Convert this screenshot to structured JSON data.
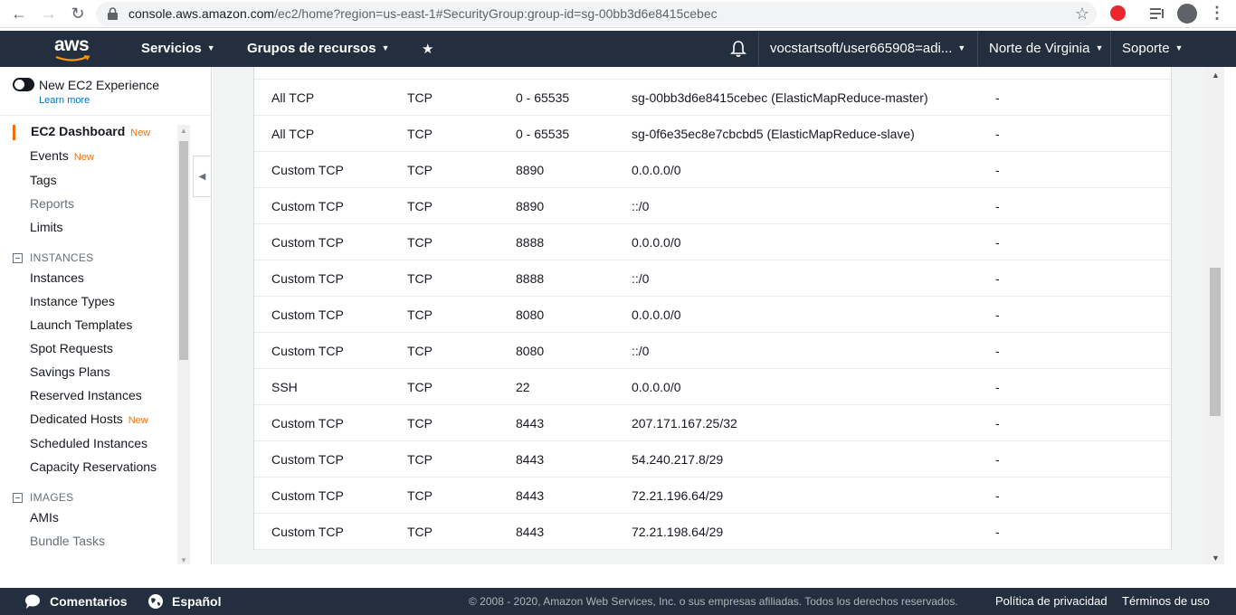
{
  "browser": {
    "url_domain": "console.aws.amazon.com",
    "url_path": "/ec2/home?region=us-east-1#SecurityGroup:group-id=sg-00bb3d6e8415cebec"
  },
  "header": {
    "logo": "aws",
    "services": "Servicios",
    "resource_groups": "Grupos de recursos",
    "account": "vocstartsoft/user665908=adi...",
    "region": "Norte de Virginia",
    "support": "Soporte"
  },
  "sidebar": {
    "new_experience": "New EC2 Experience",
    "learn_more": "Learn more",
    "badge_new": "New",
    "top_items": [
      {
        "label": "EC2 Dashboard",
        "new": true
      },
      {
        "label": "Events",
        "new": true
      },
      {
        "label": "Tags",
        "new": false
      },
      {
        "label": "Reports",
        "new": false
      },
      {
        "label": "Limits",
        "new": false
      }
    ],
    "sections": [
      {
        "title": "INSTANCES",
        "items": [
          {
            "label": "Instances"
          },
          {
            "label": "Instance Types"
          },
          {
            "label": "Launch Templates"
          },
          {
            "label": "Spot Requests"
          },
          {
            "label": "Savings Plans"
          },
          {
            "label": "Reserved Instances"
          },
          {
            "label": "Dedicated Hosts",
            "new": true
          },
          {
            "label": "Scheduled Instances"
          },
          {
            "label": "Capacity Reservations"
          }
        ]
      },
      {
        "title": "IMAGES",
        "items": [
          {
            "label": "AMIs"
          },
          {
            "label": "Bundle Tasks"
          }
        ]
      }
    ]
  },
  "rules": [
    {
      "type": "All TCP",
      "protocol": "TCP",
      "port": "0 - 65535",
      "source": "sg-00bb3d6e8415cebec (ElasticMapReduce-master)",
      "description": "-"
    },
    {
      "type": "All TCP",
      "protocol": "TCP",
      "port": "0 - 65535",
      "source": "sg-0f6e35ec8e7cbcbd5 (ElasticMapReduce-slave)",
      "description": "-"
    },
    {
      "type": "Custom TCP",
      "protocol": "TCP",
      "port": "8890",
      "source": "0.0.0.0/0",
      "description": "-"
    },
    {
      "type": "Custom TCP",
      "protocol": "TCP",
      "port": "8890",
      "source": "::/0",
      "description": "-"
    },
    {
      "type": "Custom TCP",
      "protocol": "TCP",
      "port": "8888",
      "source": "0.0.0.0/0",
      "description": "-"
    },
    {
      "type": "Custom TCP",
      "protocol": "TCP",
      "port": "8888",
      "source": "::/0",
      "description": "-"
    },
    {
      "type": "Custom TCP",
      "protocol": "TCP",
      "port": "8080",
      "source": "0.0.0.0/0",
      "description": "-"
    },
    {
      "type": "Custom TCP",
      "protocol": "TCP",
      "port": "8080",
      "source": "::/0",
      "description": "-"
    },
    {
      "type": "SSH",
      "protocol": "TCP",
      "port": "22",
      "source": "0.0.0.0/0",
      "description": "-"
    },
    {
      "type": "Custom TCP",
      "protocol": "TCP",
      "port": "8443",
      "source": "207.171.167.25/32",
      "description": "-"
    },
    {
      "type": "Custom TCP",
      "protocol": "TCP",
      "port": "8443",
      "source": "54.240.217.8/29",
      "description": "-"
    },
    {
      "type": "Custom TCP",
      "protocol": "TCP",
      "port": "8443",
      "source": "72.21.196.64/29",
      "description": "-"
    },
    {
      "type": "Custom TCP",
      "protocol": "TCP",
      "port": "8443",
      "source": "72.21.198.64/29",
      "description": "-"
    }
  ],
  "footer": {
    "feedback": "Comentarios",
    "language": "Español",
    "copyright": "© 2008 - 2020, Amazon Web Services, Inc. o sus empresas afiliadas. Todos los derechos reservados.",
    "privacy": "Política de privacidad",
    "terms": "Términos de uso"
  },
  "colors": {
    "header_bg": "#232f3e",
    "accent_orange": "#ec7211",
    "link_blue": "#0073bb"
  }
}
